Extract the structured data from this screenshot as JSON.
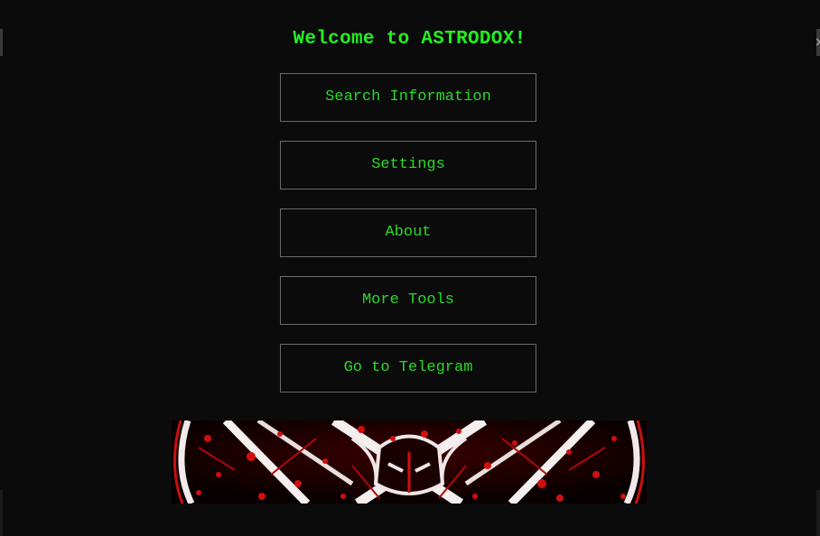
{
  "window": {
    "close_glyph": "×"
  },
  "main": {
    "title": "Welcome to ASTRODOX!",
    "menu": [
      {
        "label": "Search Information"
      },
      {
        "label": "Settings"
      },
      {
        "label": "About"
      },
      {
        "label": "More Tools"
      },
      {
        "label": "Go to Telegram"
      }
    ],
    "banner": {
      "icon": "pentagram-emblem-image"
    }
  },
  "colors": {
    "background": "#0b0b0b",
    "accent_green": "#22ee22",
    "button_border": "#6b6b6b",
    "banner_red": "#d01010"
  }
}
